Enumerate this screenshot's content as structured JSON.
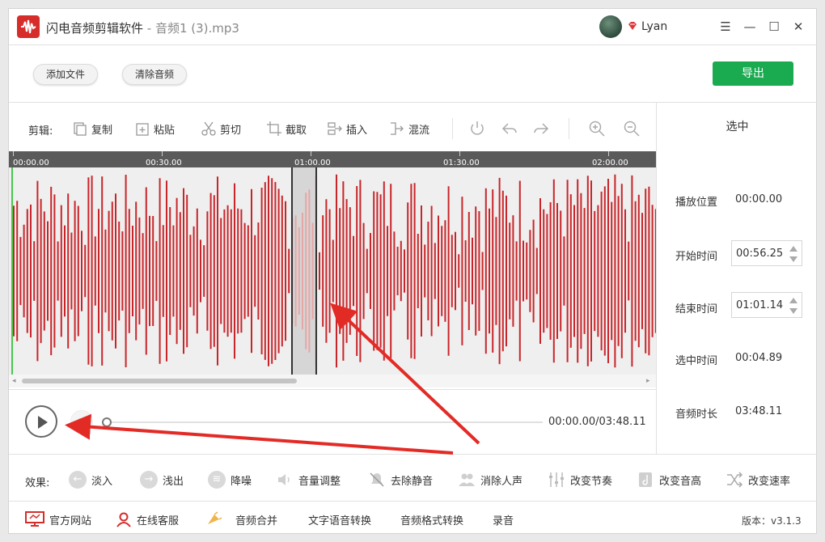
{
  "titlebar": {
    "app_name": "闪电音频剪辑软件",
    "separator": " - ",
    "file_name": "音频1 (3).mp3",
    "username": "Lyan",
    "menu_icon": "menu-icon",
    "minimize_icon": "minimize-icon",
    "maximize_icon": "maximize-icon",
    "close_icon": "close-icon"
  },
  "toolbar": {
    "add_file": "添加文件",
    "clear_audio": "清除音频",
    "export": "导出"
  },
  "edit": {
    "label": "剪辑:",
    "tools": [
      {
        "label": "复制",
        "icon": "copy-icon"
      },
      {
        "label": "粘贴",
        "icon": "paste-icon"
      },
      {
        "label": "剪切",
        "icon": "scissors-icon"
      },
      {
        "label": "截取",
        "icon": "crop-icon"
      },
      {
        "label": "插入",
        "icon": "insert-icon"
      },
      {
        "label": "混流",
        "icon": "mix-icon"
      }
    ],
    "icon_tools": [
      "reset-icon",
      "undo-icon",
      "redo-icon",
      "zoom-in-icon",
      "zoom-out-icon"
    ]
  },
  "timeline": {
    "ticks": [
      "00:00.00",
      "00:30.00",
      "01:00.00",
      "01:30.00",
      "02:00.00"
    ]
  },
  "player": {
    "time_readout": "00:00.00/03:48.11",
    "progress": 0
  },
  "side_panel": {
    "header": "选中",
    "play_position_label": "播放位置",
    "play_position": "00:00.00",
    "start_label": "开始时间",
    "start_time": "00:56.25",
    "end_label": "结束时间",
    "end_time": "01:01.14",
    "selected_label": "选中时间",
    "selected_duration": "00:04.89",
    "duration_label": "音频时长",
    "duration": "03:48.11"
  },
  "effects": {
    "label": "效果:",
    "items": [
      {
        "label": "淡入",
        "icon": "fade-in-icon"
      },
      {
        "label": "浅出",
        "icon": "fade-out-icon"
      },
      {
        "label": "降噪",
        "icon": "denoise-icon"
      },
      {
        "label": "音量调整",
        "icon": "volume-icon"
      },
      {
        "label": "去除静音",
        "icon": "mute-remove-icon"
      },
      {
        "label": "消除人声",
        "icon": "vocal-remove-icon"
      },
      {
        "label": "改变节奏",
        "icon": "tempo-icon"
      },
      {
        "label": "改变音高",
        "icon": "pitch-icon"
      },
      {
        "label": "改变速率",
        "icon": "speed-icon"
      }
    ]
  },
  "bottom_bar": {
    "website": "官方网站",
    "support": "在线客服",
    "merge": "音频合并",
    "tts": "文字语音转换",
    "format": "音频格式转换",
    "record": "录音",
    "version": "版本：v3.1.3"
  },
  "colors": {
    "waveform": "#c8252a",
    "export": "#1aaa50",
    "accent_red": "#d62d2a"
  }
}
